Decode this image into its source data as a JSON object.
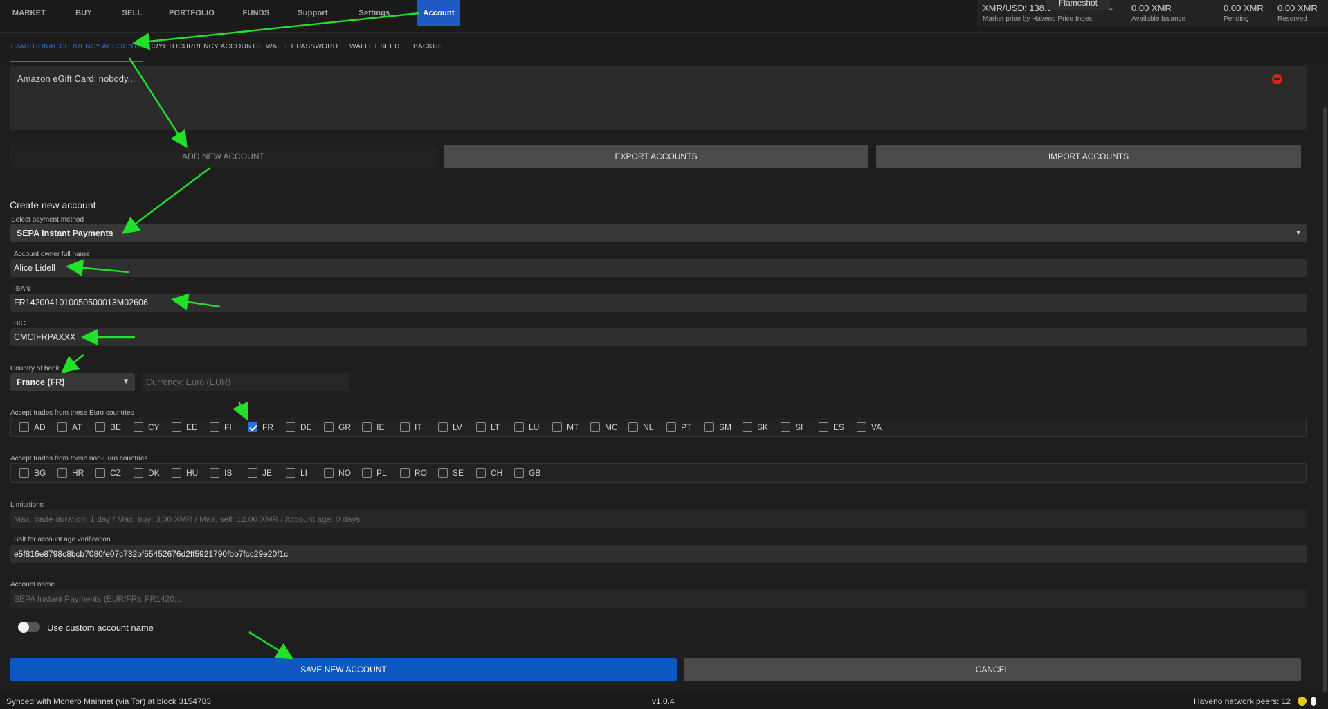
{
  "nav": {
    "items": [
      "MARKET",
      "BUY",
      "SELL",
      "PORTFOLIO",
      "FUNDS",
      "Support",
      "Settings",
      "Account"
    ]
  },
  "price": {
    "pair": "XMR/USD: 138.5",
    "source": "Market price by Haveno Price Index",
    "overlay": "Flameshot"
  },
  "balances": {
    "available": {
      "value": "0.00 XMR",
      "label": "Available balance"
    },
    "pending": {
      "value": "0.00 XMR",
      "label": "Pending"
    },
    "reserved": {
      "value": "0.00 XMR",
      "label": "Reserved"
    }
  },
  "subtabs": [
    "TRADITIONAL CURRENCY ACCOUNTS",
    "CRYPTOCURRENCY ACCOUNTS",
    "WALLET PASSWORD",
    "WALLET SEED",
    "BACKUP"
  ],
  "accounts": {
    "items": [
      "Amazon eGift Card: nobody..."
    ]
  },
  "actions": {
    "add": "ADD NEW ACCOUNT",
    "export": "EXPORT ACCOUNTS",
    "import": "IMPORT ACCOUNTS"
  },
  "form": {
    "title": "Create new account",
    "payment_method_label": "Select payment method",
    "payment_method": "SEPA Instant Payments",
    "owner_label": "Account owner full name",
    "owner": "Alice Lidell",
    "iban_label": "IBAN",
    "iban": "FR1420041010050500013M02606",
    "bic_label": "BIC",
    "bic": "CMCIFRPAXXX",
    "country_label": "Country of bank",
    "country": "France (FR)",
    "currency": "Currency: Euro (EUR)",
    "euro_label": "Accept trades from these Euro countries",
    "euro_countries": [
      "AD",
      "AT",
      "BE",
      "CY",
      "EE",
      "FI",
      "FR",
      "DE",
      "GR",
      "IE",
      "IT",
      "LV",
      "LT",
      "LU",
      "MT",
      "MC",
      "NL",
      "PT",
      "SM",
      "SK",
      "SI",
      "ES",
      "VA"
    ],
    "euro_checked": [
      "FR"
    ],
    "noneuro_label": "Accept trades from these non-Euro countries",
    "noneuro_countries": [
      "BG",
      "HR",
      "CZ",
      "DK",
      "HU",
      "IS",
      "JE",
      "LI",
      "NO",
      "PL",
      "RO",
      "SE",
      "CH",
      "GB"
    ],
    "limitations_label": "Limitations",
    "limitations": "Max. trade duration: 1 day / Max. buy: 3.00 XMR / Max. sell: 12.00 XMR / Account age: 0 days",
    "salt_label": "Salt for account age verification",
    "salt": "e5f816e8798c8bcb7080fe07c732bf55452676d2ff5921790fbb7fcc29e20f1c",
    "account_name_label": "Account name",
    "account_name": "SEPA Instant Payments (EUR/FR): FR1420...",
    "custom_name_label": "Use custom account name",
    "custom_name_on": false,
    "save": "SAVE NEW ACCOUNT",
    "cancel": "CANCEL"
  },
  "footer": {
    "sync": "Synced with Monero Mainnet (via Tor) at block 3154783",
    "version": "v1.0.4",
    "peers": "Haveno network peers: 12"
  },
  "colors": {
    "accent": "#0d57c0",
    "annotation": "#22e02a"
  }
}
